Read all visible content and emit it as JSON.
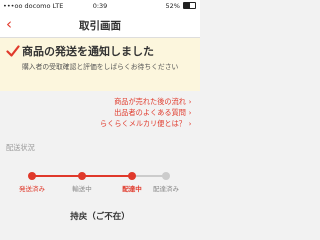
{
  "status_bar": {
    "carrier": "•••oo docomo  LTE",
    "time": "0:39",
    "battery": "52%"
  },
  "nav": {
    "back_symbol": "‹",
    "title": "取引画面"
  },
  "notice": {
    "title": "商品の発送を通知しました",
    "text": "購入者の受取確認と評価をしばらくお待ちください"
  },
  "help_links": [
    {
      "label": "商品が売れた後の流れ"
    },
    {
      "label": "出品者のよくある質問"
    },
    {
      "label": "らくらくメルカリ便とは？"
    }
  ],
  "shipping": {
    "section_label": "配送状況",
    "steps": [
      {
        "label": "発送済み",
        "state": "done"
      },
      {
        "label": "輸送中",
        "state": "done"
      },
      {
        "label": "配達中",
        "state": "current"
      },
      {
        "label": "配達済み",
        "state": "pending"
      }
    ],
    "pending_message": "持戻（ご不在）"
  },
  "colors": {
    "accent": "#e0392b",
    "inactive": "#cccccc",
    "notice_bg": "#fcf6dd"
  },
  "icons": {
    "check": "check-icon",
    "back": "chevron-left-icon",
    "link_arrow": "chevron-right-icon"
  }
}
